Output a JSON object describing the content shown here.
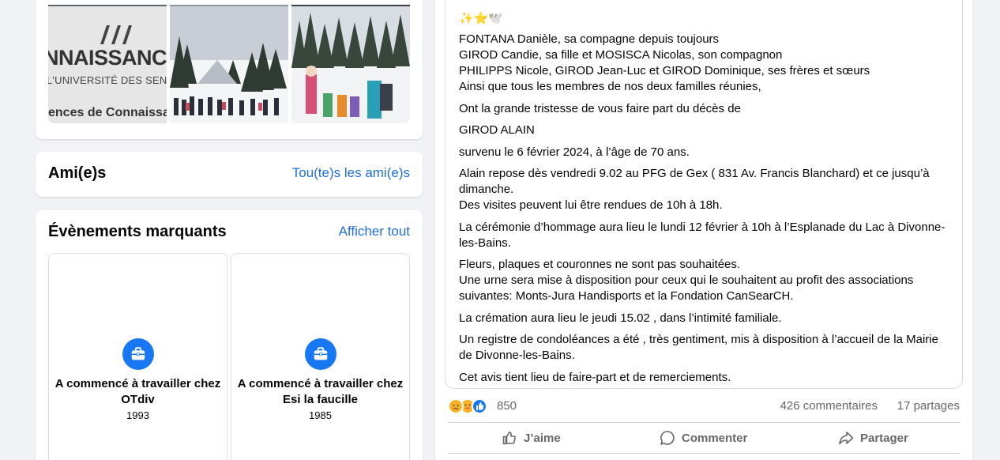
{
  "photos": {
    "photo1": {
      "big_text": "NNAISSANCE",
      "small_text": "L'UNIVERSITÉ DES SENIORS",
      "bottom_text": "ences de Connaissa"
    }
  },
  "friends": {
    "title": "Ami(e)s",
    "link": "Tou(te)s les ami(e)s"
  },
  "events": {
    "title": "Évènements marquants",
    "link": "Afficher tout",
    "items": [
      {
        "title": "A commencé à travailler chez OTdiv",
        "year": "1993",
        "icon": "briefcase-icon"
      },
      {
        "title": "A commencé à travailler chez Esi la faucille",
        "year": "1985",
        "icon": "briefcase-icon"
      }
    ]
  },
  "post": {
    "paragraphs": [
      "✨⭐🕊️",
      "FONTANA Danièle, sa compagne depuis toujours\nGIROD Candie, sa fille et MOSISCA Nicolas, son compagnon\nPHILIPPS Nicole, GIROD Jean-Luc et GIROD Dominique, ses frères et sœurs\nAinsi que tous les membres de nos deux familles réunies,",
      "Ont la grande tristesse de vous faire part du décès de",
      "GIROD ALAIN",
      "survenu le 6 février 2024, à l’âge de 70 ans.",
      "Alain repose dès vendredi 9.02 au PFG de Gex ( 831 Av. Francis Blanchard) et ce jusqu’à dimanche.\nDes visites peuvent lui être rendues de 10h à 18h.",
      "La cérémonie d’hommage aura lieu le lundi 12 février à 10h à l’Esplanade du Lac à Divonne-les-Bains.",
      "Fleurs, plaques et couronnes ne sont pas souhaitées.\nUne urne sera mise à disposition pour ceux qui le souhaitent au profit des associations suivantes: Monts-Jura Handisports et la Fondation CanSearCH.",
      "La crémation aura lieu le jeudi 15.02 , dans l’intimité familiale.",
      "Un registre de condoléances a été , très gentiment, mis à disposition à l’accueil de la Mairie de Divonne-les-Bains.",
      "Cet avis tient lieu de faire-part et de remerciements."
    ],
    "reactions": {
      "count": "850",
      "comments": "426 commentaires",
      "shares": "17 partages",
      "icons": [
        "sad-reaction-icon",
        "care-reaction-icon",
        "like-reaction-icon"
      ]
    },
    "actions": {
      "like": "J’aime",
      "comment": "Commenter",
      "share": "Partager"
    }
  },
  "colors": {
    "link": "#216fdb",
    "accent": "#1877f2",
    "muted": "#65676b",
    "background": "#f0f2f5"
  }
}
